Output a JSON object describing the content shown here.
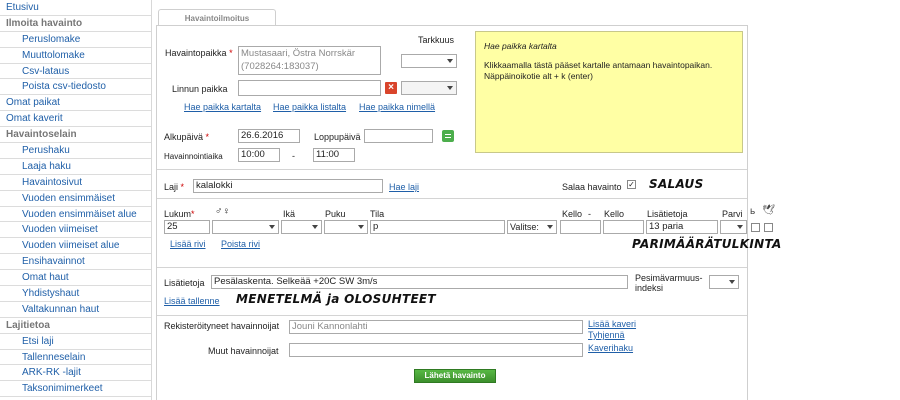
{
  "sidebar": {
    "items": [
      {
        "label": "Etusivu",
        "kind": "link"
      },
      {
        "label": "Ilmoita havainto",
        "kind": "head"
      },
      {
        "label": "Peruslomake",
        "kind": "sub"
      },
      {
        "label": "Muuttolomake",
        "kind": "sub"
      },
      {
        "label": "Csv-lataus",
        "kind": "sub"
      },
      {
        "label": "Poista csv-tiedosto",
        "kind": "sub"
      },
      {
        "label": "Omat paikat",
        "kind": "link"
      },
      {
        "label": "Omat kaverit",
        "kind": "link"
      },
      {
        "label": "Havaintoselain",
        "kind": "head"
      },
      {
        "label": "Perushaku",
        "kind": "sub"
      },
      {
        "label": "Laaja haku",
        "kind": "sub"
      },
      {
        "label": "Havaintosivut",
        "kind": "sub"
      },
      {
        "label": "Vuoden ensimmäiset",
        "kind": "sub"
      },
      {
        "label": "Vuoden ensimmäiset alue",
        "kind": "sub"
      },
      {
        "label": "Vuoden viimeiset",
        "kind": "sub"
      },
      {
        "label": "Vuoden viimeiset alue",
        "kind": "sub"
      },
      {
        "label": "Ensihavainnot",
        "kind": "sub"
      },
      {
        "label": "Omat haut",
        "kind": "sub"
      },
      {
        "label": "Yhdistyshaut",
        "kind": "sub"
      },
      {
        "label": "Valtakunnan haut",
        "kind": "sub"
      },
      {
        "label": "Lajitietoa",
        "kind": "head"
      },
      {
        "label": "Etsi laji",
        "kind": "sub"
      },
      {
        "label": "Tallenneselain",
        "kind": "sub"
      },
      {
        "label": "ARK-RK -lajit",
        "kind": "sub"
      },
      {
        "label": "Taksonimimerkeet",
        "kind": "sub"
      }
    ]
  },
  "form": {
    "tab_label": "Havaintoilmoitus",
    "place": {
      "label": "Havaintopaikka",
      "value_line1": "Mustasaari, Östra Norrskär",
      "value_line2": "(7028264:183037)",
      "accuracy_label": "Tarkkuus"
    },
    "bird_place": {
      "label": "Linnun paikka"
    },
    "place_links": {
      "map": "Hae paikka kartalta",
      "list": "Hae paikka listalta",
      "name": "Hae paikka nimellä"
    },
    "help_box": {
      "title": "Hae paikka kartalta",
      "body": "Klikkaamalla tästä pääset kartalle antamaan havaintopaikan. Näppäinoikotie alt + k (enter)"
    },
    "dates": {
      "start_label": "Alkupäivä",
      "start_value": "26.6.2016",
      "end_label": "Loppupäivä",
      "end_value": "",
      "time_label": "Havainnointiaika",
      "time_start": "10:00",
      "time_sep": "-",
      "time_end": "11:00"
    },
    "species": {
      "label": "Laji",
      "value": "kalalokki",
      "link": "Hae laji",
      "secret_label": "Salaa havainto",
      "secret_checked": true,
      "annotation": "SALAUS"
    },
    "row_headers": {
      "count": "Lukum",
      "sex_symbol": "♂♀",
      "age": "Ikä",
      "plumage": "Puku",
      "state": "Tila",
      "time_from": "Kello",
      "time_dash": "-",
      "time_to": "Kello",
      "extra": "Lisätietoja",
      "flock": "Parvi"
    },
    "row_values": {
      "count": "25",
      "state": "p",
      "state_select": "Valitse:",
      "extra": "13 paria"
    },
    "row_links": {
      "add_row": "Lisää rivi",
      "remove_row": "Poista rivi"
    },
    "row_annotation": "PARIMÄÄRÄTULKINTA",
    "notes": {
      "label": "Lisätietoja",
      "value": "Pesälaskenta. Selkeää +20C SW 3m/s",
      "breeding_label_1": "Pesimävarmuus-",
      "breeding_label_2": "indeksi",
      "add_recording": "Lisää tallenne",
      "annotation": "MENETELMÄ ja OLOSUHTEET"
    },
    "observers": {
      "registered_label": "Rekisteröityneet havainnoijat",
      "registered_value": "Jouni Kannonlahti",
      "add_friend": "Lisää kaveri",
      "clear": "Tyhjennä",
      "other_label": "Muut havainnoijat",
      "friend_search": "Kaverihaku"
    },
    "submit_label": "Lähetä havainto"
  },
  "colors": {
    "link": "#1f5fa8",
    "help_box": "#ffffa4",
    "submit": "#4cae4c",
    "remove": "#d9442b"
  }
}
